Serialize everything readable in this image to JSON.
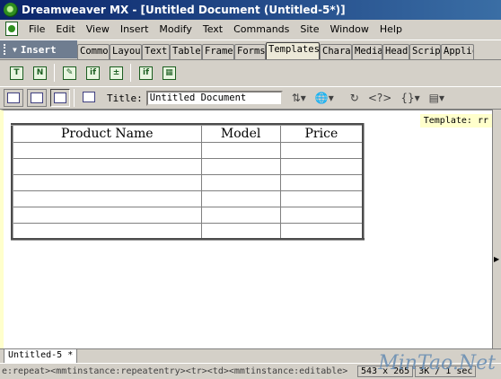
{
  "window": {
    "title": "Dreamweaver MX - [Untitled Document (Untitled-5*)]"
  },
  "menubar": {
    "items": [
      "File",
      "Edit",
      "View",
      "Insert",
      "Modify",
      "Text",
      "Commands",
      "Site",
      "Window",
      "Help"
    ]
  },
  "insertbar": {
    "label": "Insert",
    "tabs": [
      "Common",
      "Layout",
      "Text",
      "Tables",
      "Frames",
      "Forms",
      "Templates",
      "Characters",
      "Media",
      "Head",
      "Script",
      "Application"
    ],
    "active_tab": "Templates"
  },
  "template_icons": [
    "template-icon",
    "editable-region-icon",
    "optional-region-icon",
    "repeating-region-icon",
    "repeating-table-icon",
    "editable-tag-attribute-icon",
    "nested-template-icon"
  ],
  "doc_toolbar": {
    "title_label": "Title:",
    "title_value": "Untitled Document"
  },
  "document": {
    "template_tag": "Template: rr",
    "table": {
      "headers": [
        "Product Name",
        "Model",
        "Price"
      ],
      "rows": [
        [
          "",
          "",
          ""
        ],
        [
          "",
          "",
          ""
        ],
        [
          "",
          "",
          ""
        ],
        [
          "",
          "",
          ""
        ],
        [
          "",
          "",
          ""
        ],
        [
          "",
          "",
          ""
        ]
      ]
    }
  },
  "doc_tab": {
    "label": "Untitled-5 *"
  },
  "statusbar": {
    "tag_path": "e:repeat><mmtinstance:repeatentry><tr><td><mmtinstance:editable>",
    "window_size": "543 x 265",
    "download": "3K / 1 sec"
  },
  "watermark": "MinTao.Net"
}
